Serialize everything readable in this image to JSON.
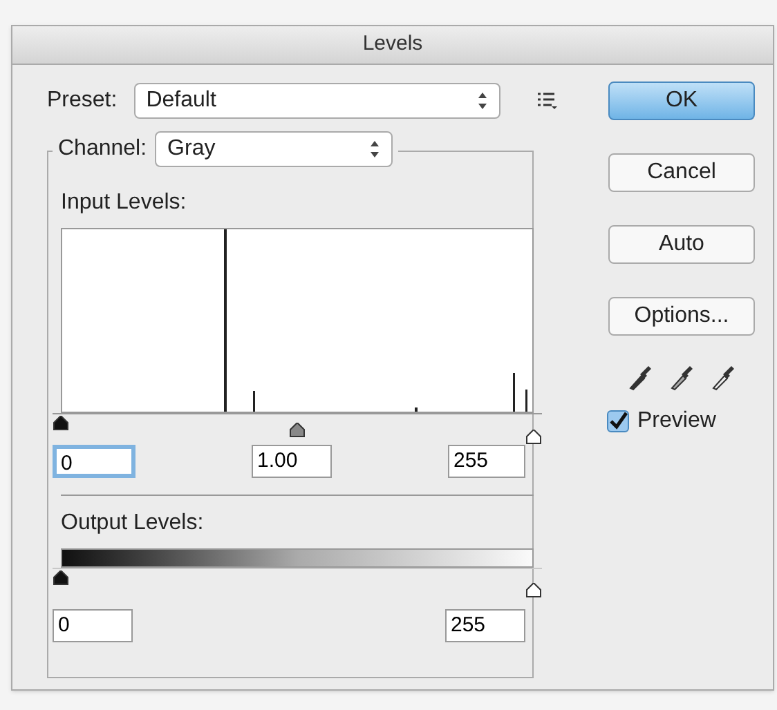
{
  "window": {
    "title": "Levels"
  },
  "preset": {
    "label": "Preset:",
    "value": "Default"
  },
  "channel": {
    "label": "Channel:",
    "value": "Gray"
  },
  "input_levels": {
    "label": "Input Levels:",
    "handles": [
      {
        "kind": "black",
        "level": 0
      },
      {
        "kind": "gray",
        "level": 0.5
      },
      {
        "kind": "white",
        "level": 1
      }
    ],
    "fields": [
      {
        "value": "0",
        "focused": true
      },
      {
        "value": "1.00",
        "focused": false
      },
      {
        "value": "255",
        "focused": false
      }
    ]
  },
  "output_levels": {
    "label": "Output Levels:",
    "handles": [
      {
        "kind": "black",
        "level": 0
      },
      {
        "kind": "white",
        "level": 1
      }
    ],
    "fields": [
      {
        "value": "0",
        "focused": false
      },
      {
        "value": "255",
        "focused": false
      }
    ]
  },
  "buttons": [
    {
      "label": "OK",
      "default": true
    },
    {
      "label": "Cancel",
      "default": false
    },
    {
      "label": "Auto",
      "default": false
    },
    {
      "label": "Options...",
      "default": false
    }
  ],
  "preview": {
    "label": "Preview",
    "checked": true
  }
}
